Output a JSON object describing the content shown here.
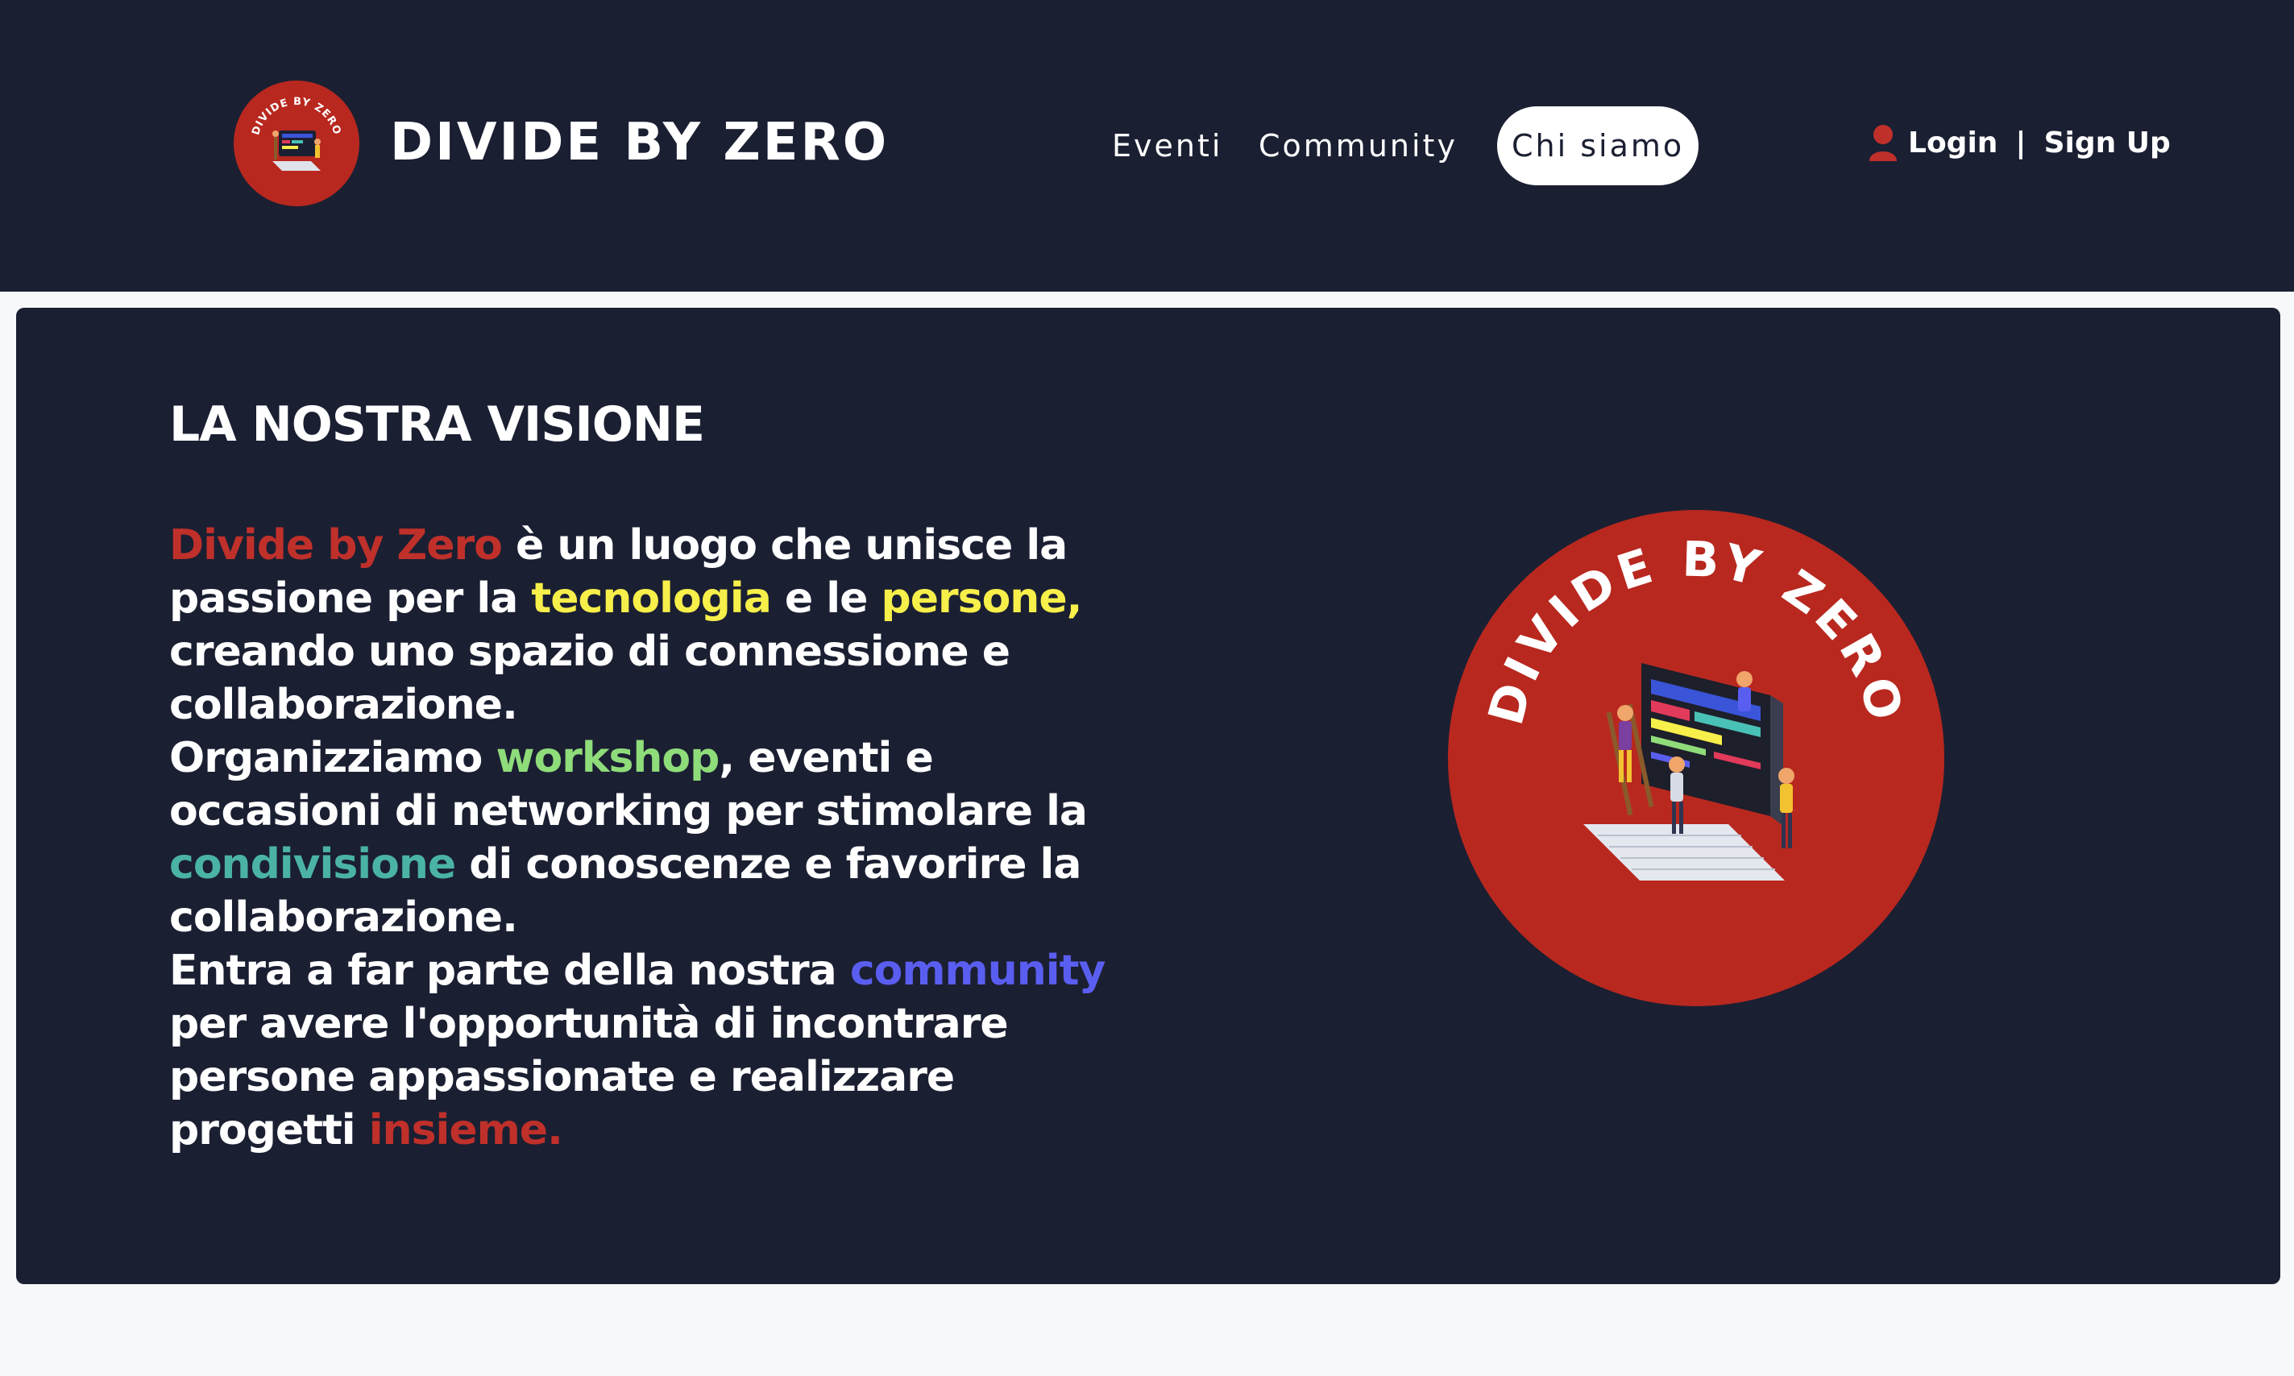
{
  "header": {
    "logo_text": "DIVIDE BY ZERO",
    "brand_title": "DIVIDE BY ZERO",
    "nav": [
      {
        "label": "Eventi"
      },
      {
        "label": "Community"
      },
      {
        "label": "Chi siamo",
        "active": true
      }
    ],
    "auth": {
      "login_label": "Login",
      "separator": "|",
      "signup_label": "Sign Up"
    }
  },
  "vision": {
    "title": "LA NOSTRA VISIONE",
    "lines": [
      [
        {
          "text": "Divide by Zero",
          "color": "red"
        },
        {
          "text": " è un luogo che unisce la"
        }
      ],
      [
        {
          "text": "passione per la "
        },
        {
          "text": "tecnologia",
          "color": "yellow"
        },
        {
          "text": " e le "
        },
        {
          "text": "persone,",
          "color": "yellow"
        }
      ],
      [
        {
          "text": "creando uno spazio di connessione e"
        }
      ],
      [
        {
          "text": "collaborazione."
        }
      ],
      [
        {
          "text": "Organizziamo "
        },
        {
          "text": "workshop",
          "color": "green"
        },
        {
          "text": ", eventi e"
        }
      ],
      [
        {
          "text": "occasioni di networking per stimolare la"
        }
      ],
      [
        {
          "text": "condivisione",
          "color": "teal"
        },
        {
          "text": " di conoscenze e favorire la"
        }
      ],
      [
        {
          "text": "collaborazione."
        }
      ],
      [
        {
          "text": "Entra a far parte della nostra "
        },
        {
          "text": "community",
          "color": "blue"
        }
      ],
      [
        {
          "text": "per avere l'opportunità di incontrare"
        }
      ],
      [
        {
          "text": "persone appassionate e realizzare"
        }
      ],
      [
        {
          "text": "progetti "
        },
        {
          "text": "insieme.",
          "color": "red"
        }
      ]
    ],
    "logo_text": "DIVIDE BY ZERO"
  },
  "colors": {
    "background_dark": "#1b1f32",
    "brand_red": "#b8281f",
    "red": "#c0302a",
    "yellow": "#f7ef4a",
    "green": "#8fdc7a",
    "teal": "#4ab3a6",
    "blue": "#5a5ef0"
  }
}
